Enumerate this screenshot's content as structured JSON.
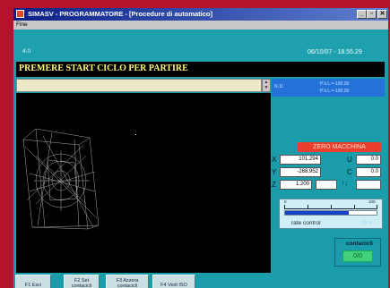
{
  "window": {
    "title": "SIMASV - PROGRAMMATORE - [Procedure di automatico]",
    "controls": {
      "minimize": "_",
      "restore": "▫",
      "close": "✕"
    }
  },
  "menu": {
    "items": [
      {
        "label": "Fine"
      }
    ]
  },
  "info": {
    "version": "4.0",
    "datetime": "06/10/07 - 18.55.29"
  },
  "message": "PREMERE START CICLO PER PARTIRE",
  "program": {
    "line": "N.11",
    "codes": [
      "P.V.L.=-180.00",
      "P.V.L.=-180.00"
    ]
  },
  "status": {
    "label": "ZERO MACCHINA",
    "color": "#ec3f2b"
  },
  "axes": [
    {
      "name": "X",
      "value": "101.294"
    },
    {
      "name": "U",
      "value": "0.0"
    },
    {
      "name": "Y",
      "value": "-268.952"
    },
    {
      "name": "C",
      "value": "0.0"
    },
    {
      "name": "Z",
      "value": "1.200"
    },
    {
      "name": "↑↓",
      "value": ""
    }
  ],
  "rate_control": {
    "label": "rate control",
    "percent_text": "70 %",
    "level": 0.7,
    "scale_min": "0",
    "scale_max": "100"
  },
  "contacts": {
    "title": "contacicli",
    "value": "0/0"
  },
  "function_keys": [
    {
      "label": "F1 Esci"
    },
    {
      "label": "F2 Set contacicli"
    },
    {
      "label": "F3 Azzera contacicli"
    },
    {
      "label": "F4 Vedi ISO"
    }
  ],
  "colors": {
    "background": "#1b9cab",
    "accent": "#b5122c",
    "message_text": "#fff47a"
  },
  "icons": {
    "app": "app-icon",
    "scroll": "scroll-arrows-icon"
  }
}
